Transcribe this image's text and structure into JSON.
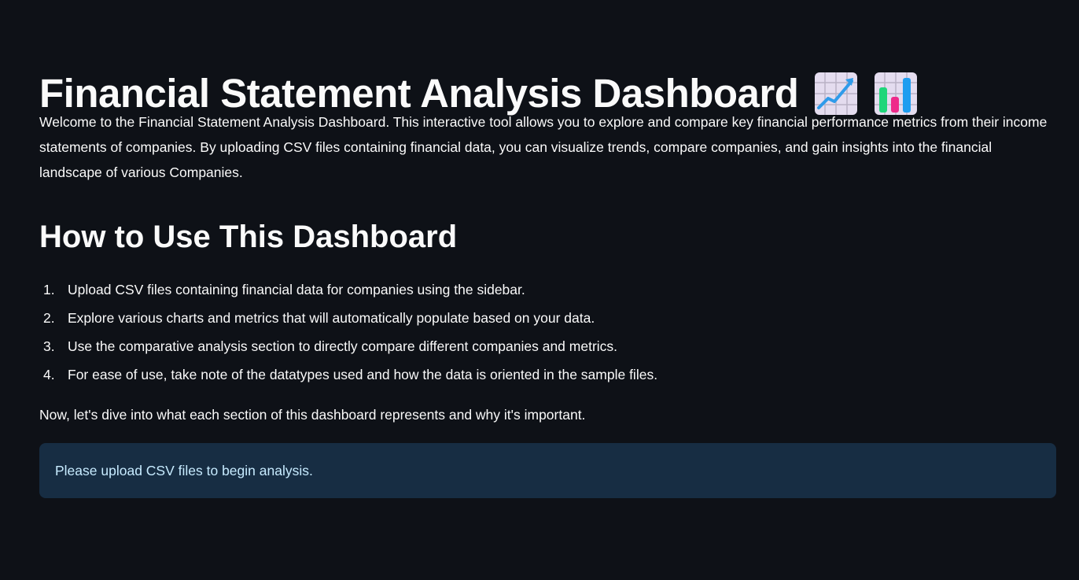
{
  "page": {
    "title": "Financial Statement Analysis Dashboard",
    "title_icons": [
      "chart-increasing-icon",
      "bar-chart-icon"
    ],
    "intro": "Welcome to the Financial Statement Analysis Dashboard. This interactive tool allows you to explore and compare key financial performance metrics from their income statements of companies. By uploading CSV files containing financial data, you can visualize trends, compare companies, and gain insights into the financial landscape of various Companies."
  },
  "how_to": {
    "heading": "How to Use This Dashboard",
    "steps": [
      {
        "number": "1.",
        "text": "Upload CSV files containing financial data for companies using the sidebar."
      },
      {
        "number": "2.",
        "text": "Explore various charts and metrics that will automatically populate based on your data."
      },
      {
        "number": "3.",
        "text": "Use the comparative analysis section to directly compare different companies and metrics."
      },
      {
        "number": "4.",
        "text": "For ease of use, take note of the datatypes used and how the data is oriented in the sample files."
      }
    ],
    "closing": "Now, let's dive into what each section of this dashboard represents and why it's important."
  },
  "info_box": {
    "message": "Please upload CSV files to begin analysis."
  },
  "colors": {
    "background": "#0e1117",
    "text": "#fafafa",
    "info_bg": "#172d43",
    "info_text": "#c7ebff"
  }
}
